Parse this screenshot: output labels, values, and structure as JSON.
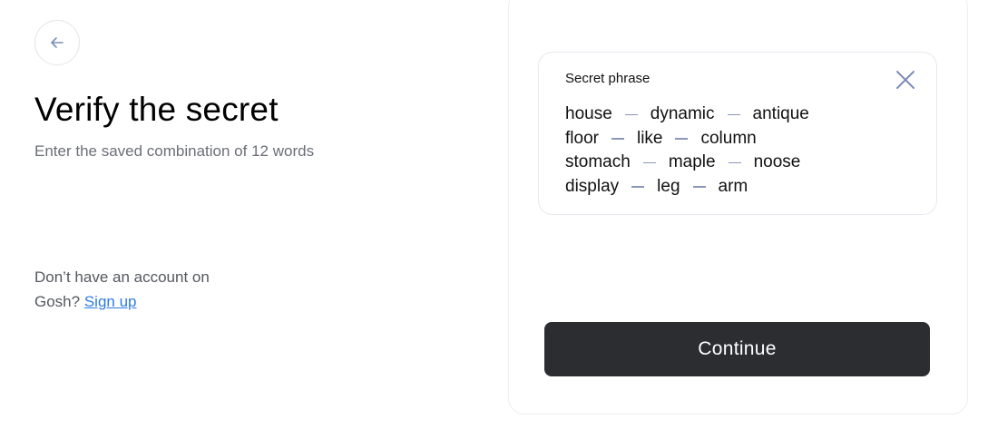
{
  "back_button": {
    "icon": "arrow-left-icon"
  },
  "title": "Verify the secret",
  "subtitle": "Enter the saved combination of 12 words",
  "signup": {
    "text": "Don’t have an account on Gosh?",
    "link_label": "Sign up"
  },
  "phrase_card": {
    "label": "Secret phrase",
    "close_icon": "close-icon",
    "rows": [
      [
        "house",
        "dynamic",
        "antique"
      ],
      [
        "floor",
        "like",
        "column"
      ],
      [
        "stomach",
        "maple",
        "noose"
      ],
      [
        "display",
        "leg",
        "arm"
      ]
    ]
  },
  "continue_label": "Continue",
  "colors": {
    "accent_link": "#2c7be5",
    "button_bg": "#2b2d31",
    "icon": "#7d8db8"
  }
}
